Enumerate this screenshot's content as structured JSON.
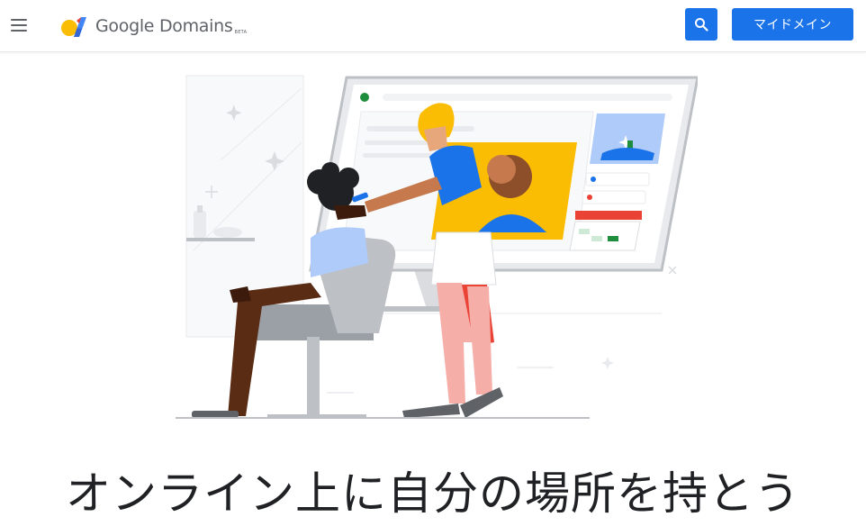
{
  "header": {
    "menu_icon": "hamburger-menu-icon",
    "logo": {
      "text": "Google Domains",
      "badge": "BETA",
      "colors": {
        "yellow": "#fbbc04",
        "red": "#ea4335",
        "blue": "#4285f4"
      }
    },
    "search_icon": "search-icon",
    "my_domain_label": "マイドメイン"
  },
  "hero": {
    "illustration": "salon-website-illustration",
    "headline": "オンライン上に自分の場所を持とう"
  },
  "colors": {
    "accent": "#1a73e8",
    "text": "#202124",
    "muted": "#5f6368"
  }
}
